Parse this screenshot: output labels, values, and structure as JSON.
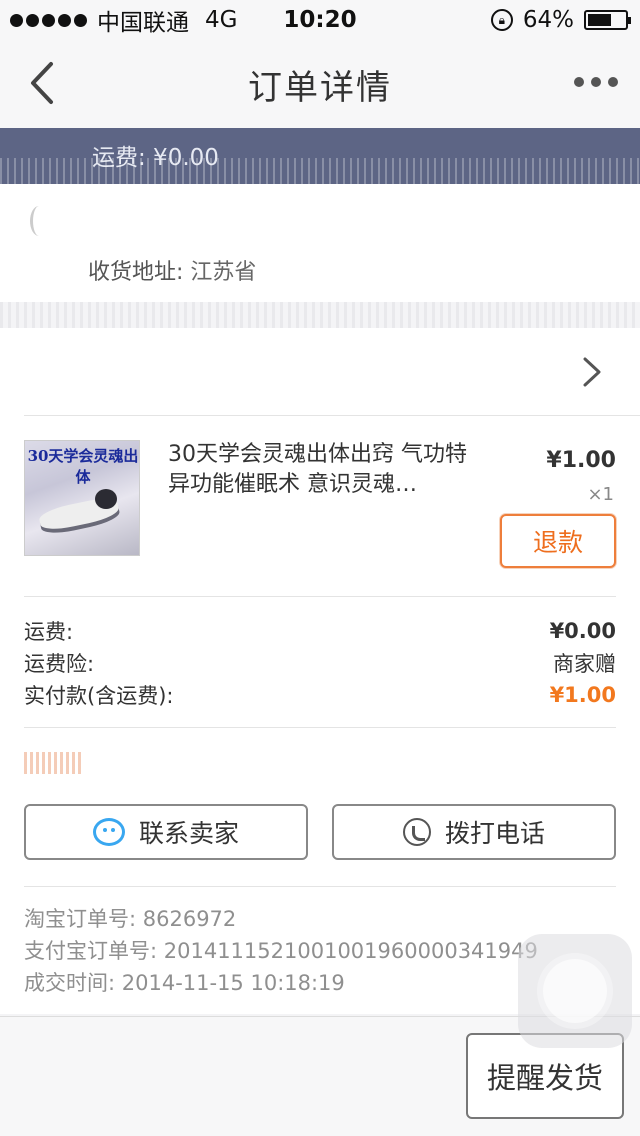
{
  "status_bar": {
    "carrier": "中国联通",
    "network": "4G",
    "time": "10:20",
    "battery": "64%",
    "battery_level": 0.64
  },
  "nav": {
    "title": "订单详情"
  },
  "banner": {
    "text": "运费: ¥0.00"
  },
  "address": {
    "label": "收货地址: ",
    "value": "江苏省"
  },
  "product": {
    "thumb_caption": "30天学会灵魂出体",
    "title": "30天学会灵魂出体出窍 气功特异功能催眠术 意识灵魂…",
    "price": "¥1.00",
    "quantity": "×1",
    "refund_label": "退款"
  },
  "fees": {
    "shipping_label": "运费:",
    "shipping_value": "¥0.00",
    "insurance_label": "运费险:",
    "insurance_value": "商家赠",
    "paid_label": "实付款(含运费):",
    "paid_value": "¥1.00"
  },
  "actions": {
    "contact_seller": "联系卖家",
    "call_phone": "拨打电话"
  },
  "order_info": {
    "taobao_no": "淘宝订单号: 8626972",
    "alipay_no": "支付宝订单号: 2014111521001001960000341949",
    "deal_time": "成交时间: 2014-11-15 10:18:19"
  },
  "bottom": {
    "remind_label": "提醒发货"
  },
  "colors": {
    "banner": "#5d6585",
    "accent_orange": "#f2781e",
    "wangwang_blue": "#39a7f0"
  }
}
